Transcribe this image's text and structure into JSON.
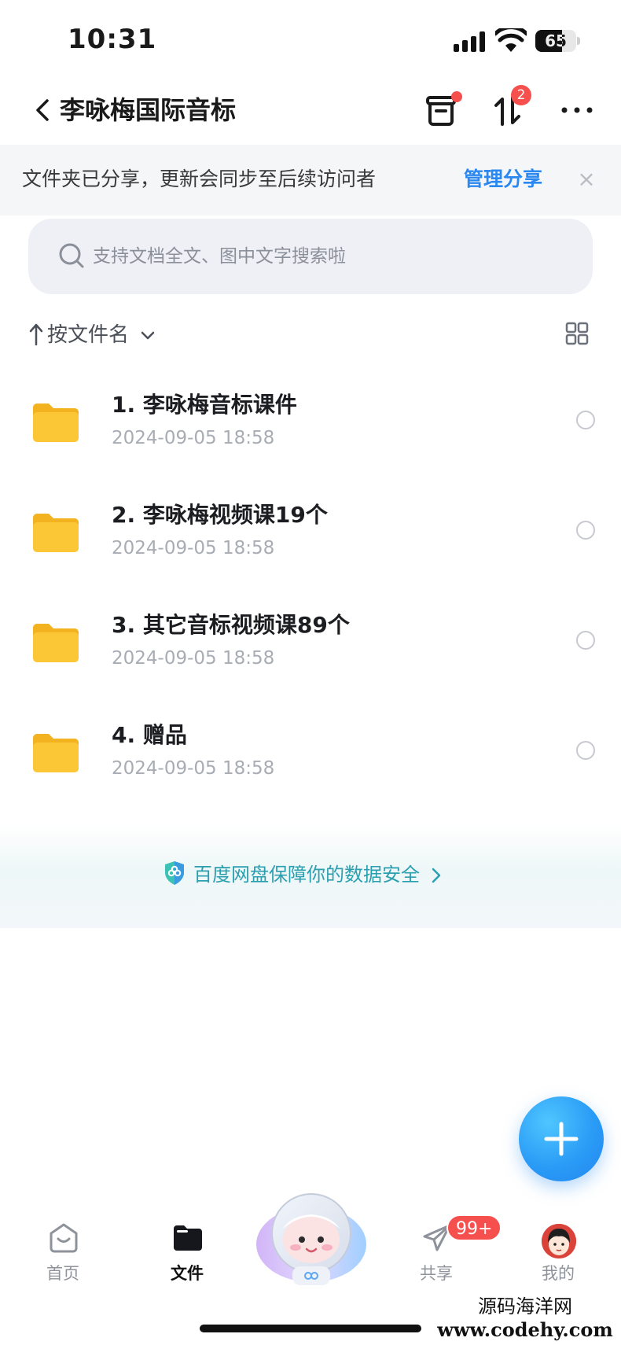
{
  "status_bar": {
    "time": "10:31",
    "battery": "65",
    "battery_level": 0.65
  },
  "nav": {
    "title": "李咏梅国际音标",
    "transfer_badge": "2"
  },
  "share_banner": {
    "text": "文件夹已分享，更新会同步至后续访问者",
    "action": "管理分享",
    "close": "×"
  },
  "search": {
    "placeholder": "支持文档全文、图中文字搜索啦"
  },
  "sort": {
    "label": "按文件名"
  },
  "files": [
    {
      "name": "1. 李咏梅音标课件",
      "date": "2024-09-05 18:58"
    },
    {
      "name": "2. 李咏梅视频课19个",
      "date": "2024-09-05 18:58"
    },
    {
      "name": "3. 其它音标视频课89个",
      "date": "2024-09-05 18:58"
    },
    {
      "name": "4. 赠品",
      "date": "2024-09-05 18:58"
    }
  ],
  "safety": {
    "text": "百度网盘保障你的数据安全"
  },
  "tabs": [
    {
      "label": "首页",
      "icon": "home-icon"
    },
    {
      "label": "文件",
      "icon": "folder-icon"
    },
    {
      "label": "共享",
      "icon": "send-icon"
    },
    {
      "label": "我的",
      "icon": "avatar"
    }
  ],
  "share_tab_badge": "99+",
  "watermark": {
    "line1": "源码海洋网",
    "line2": "www.codehy.com"
  },
  "colors": {
    "accent": "#2a88f0",
    "badge": "#f5504e",
    "folder": "#fcc736",
    "safety_text": "#2a9fb0"
  }
}
